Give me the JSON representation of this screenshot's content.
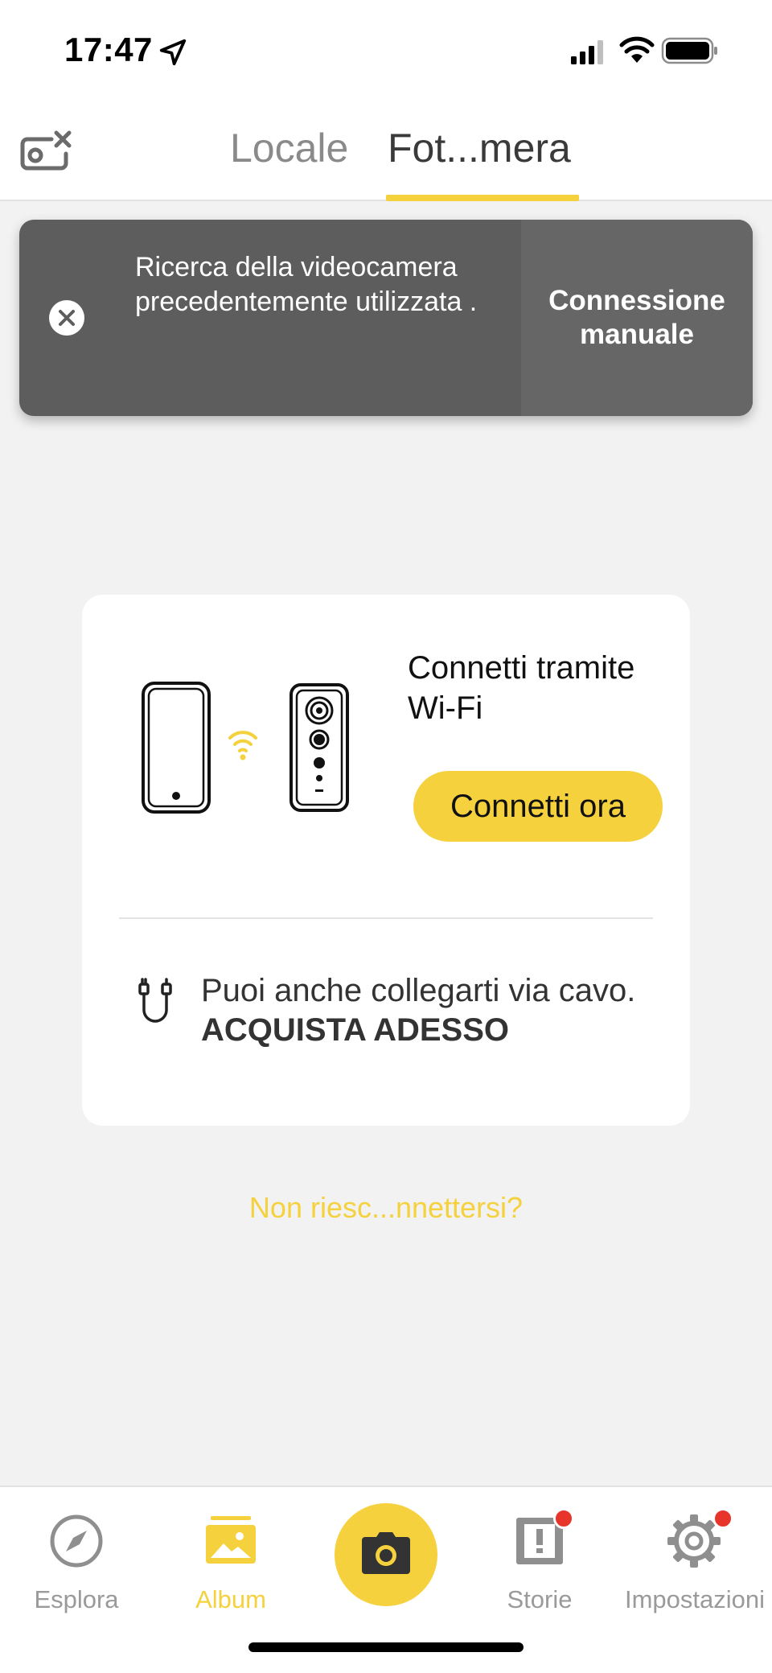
{
  "status_bar": {
    "time": "17:47",
    "icons": [
      "location-arrow-icon",
      "cellular-signal-icon",
      "wifi-icon",
      "battery-icon"
    ]
  },
  "top_nav": {
    "left_icon": "camera-disconnected-icon",
    "tabs": [
      {
        "label": "Locale",
        "selected": false
      },
      {
        "label": "Fot...mera",
        "selected": true
      }
    ],
    "accent_color": "#f4d13d"
  },
  "toast": {
    "close_icon": "close-circle-icon",
    "message": "Ricerca della videocamera precedentemente utilizzata .",
    "action_label": "Connessione manuale"
  },
  "connect_card": {
    "illustration": "phone-wifi-camera-illustration",
    "title": "Connetti tramite Wi-Fi",
    "button_label": "Connetti ora",
    "cable_icon": "cable-icon",
    "cable_text": "Puoi anche collegarti via cavo.",
    "cable_link": "ACQUISTA ADESSO"
  },
  "help_link": "Non riesc...nnettersi?",
  "bottom_nav": {
    "items": [
      {
        "label": "Esplora",
        "icon": "compass-icon",
        "active": false,
        "badge": false
      },
      {
        "label": "Album",
        "icon": "album-icon",
        "active": true,
        "badge": false
      },
      {
        "label": "",
        "icon": "camera-shutter-icon",
        "active": false,
        "badge": false
      },
      {
        "label": "Storie",
        "icon": "stories-icon",
        "active": false,
        "badge": true
      },
      {
        "label": "Impostazioni",
        "icon": "gear-icon",
        "active": false,
        "badge": true
      }
    ],
    "badge_color": "#e8352b"
  }
}
